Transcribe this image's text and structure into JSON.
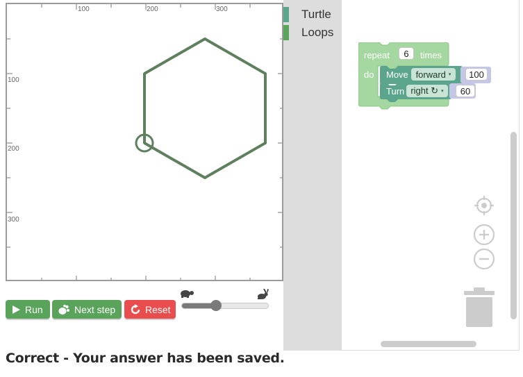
{
  "canvas": {
    "x_ticks": [
      "100",
      "200",
      "300"
    ],
    "y_ticks": [
      "100",
      "200",
      "300"
    ],
    "shape_color": "#5f7f5e"
  },
  "controls": {
    "run_label": "Run",
    "step_label": "Next step",
    "reset_label": "Reset",
    "speed_level": 0.4,
    "run_color": "#59a35a",
    "reset_color": "#e94d4d"
  },
  "status": {
    "message": "Correct - Your answer has been saved."
  },
  "toolbox": {
    "categories": [
      {
        "label": "Turtle",
        "color": "#5ba58c"
      },
      {
        "label": "Loops",
        "color": "#5ba55b"
      }
    ]
  },
  "workspace": {
    "repeat_block": {
      "label_repeat": "repeat",
      "count": "6",
      "label_times": "times",
      "label_do": "do",
      "color": "#a5d7a0"
    },
    "move_block": {
      "label": "Move",
      "direction": "forward",
      "distance": "100",
      "color": "#5ba58c"
    },
    "turn_block": {
      "label": "Turn",
      "direction": "right ↻",
      "angle": "60",
      "color": "#5ba58c"
    },
    "icons": [
      "locate-icon",
      "zoom-in-icon",
      "zoom-out-icon",
      "trash-icon"
    ]
  }
}
